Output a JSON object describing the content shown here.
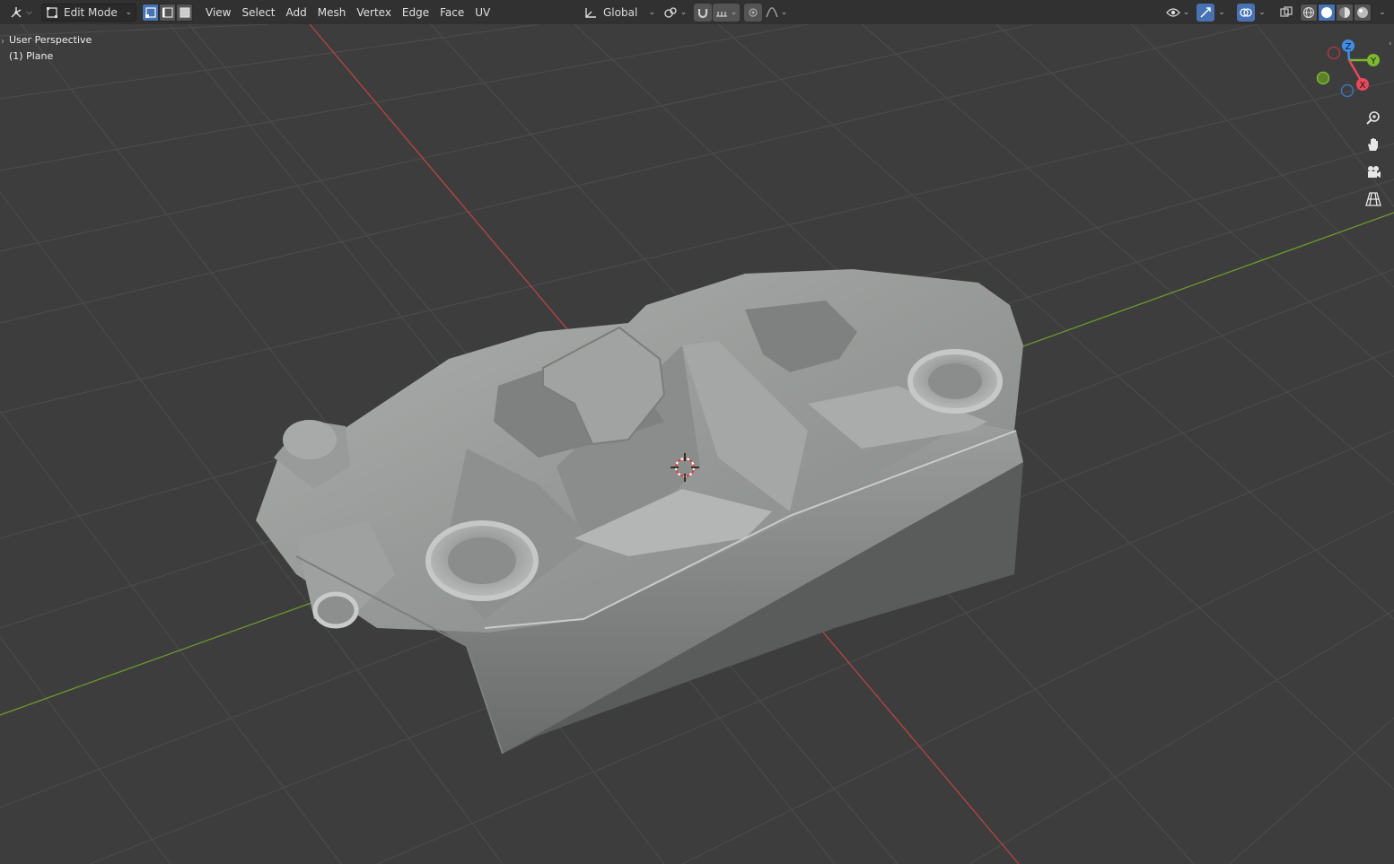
{
  "header": {
    "editor_type_icon": "editor-type-3d-viewport-icon",
    "mode": "Edit Mode",
    "select_modes": [
      "vertex",
      "edge",
      "face"
    ],
    "menus": [
      "View",
      "Select",
      "Add",
      "Mesh",
      "Vertex",
      "Edge",
      "Face",
      "UV"
    ],
    "transform_orientation": "Global",
    "pivot_icon": "pivot-point-icon",
    "snap_icon": "magnet-icon",
    "snap_target_icon": "snap-increment-icon",
    "proportional_icon": "proportional-edit-icon",
    "falloff_icon": "falloff-curve-icon",
    "right_icons": [
      "visibility-eye-icon",
      "gizmo-icon",
      "overlays-icon",
      "xray-icon",
      "wireframe-shading-icon",
      "solid-shading-icon",
      "material-shading-icon",
      "rendered-shading-icon"
    ]
  },
  "viewport": {
    "view_name": "User Perspective",
    "object_name": "(1) Plane",
    "colors": {
      "background": "#3d3d3d",
      "grid": "#4a4a4a",
      "x_axis": "#c24a4a",
      "y_axis": "#6e9a2e",
      "mesh": "#8f9290",
      "mesh_light": "#b7bab8",
      "mesh_dark": "#6b6d6c"
    }
  },
  "nav_gizmo": {
    "axes": [
      "X",
      "Y",
      "Z"
    ],
    "colors": {
      "x": "#e8485c",
      "y": "#7db82e",
      "z": "#3e8ee6"
    }
  },
  "nav_buttons": [
    "zoom-icon",
    "pan-hand-icon",
    "camera-view-icon",
    "perspective-ortho-icon"
  ]
}
